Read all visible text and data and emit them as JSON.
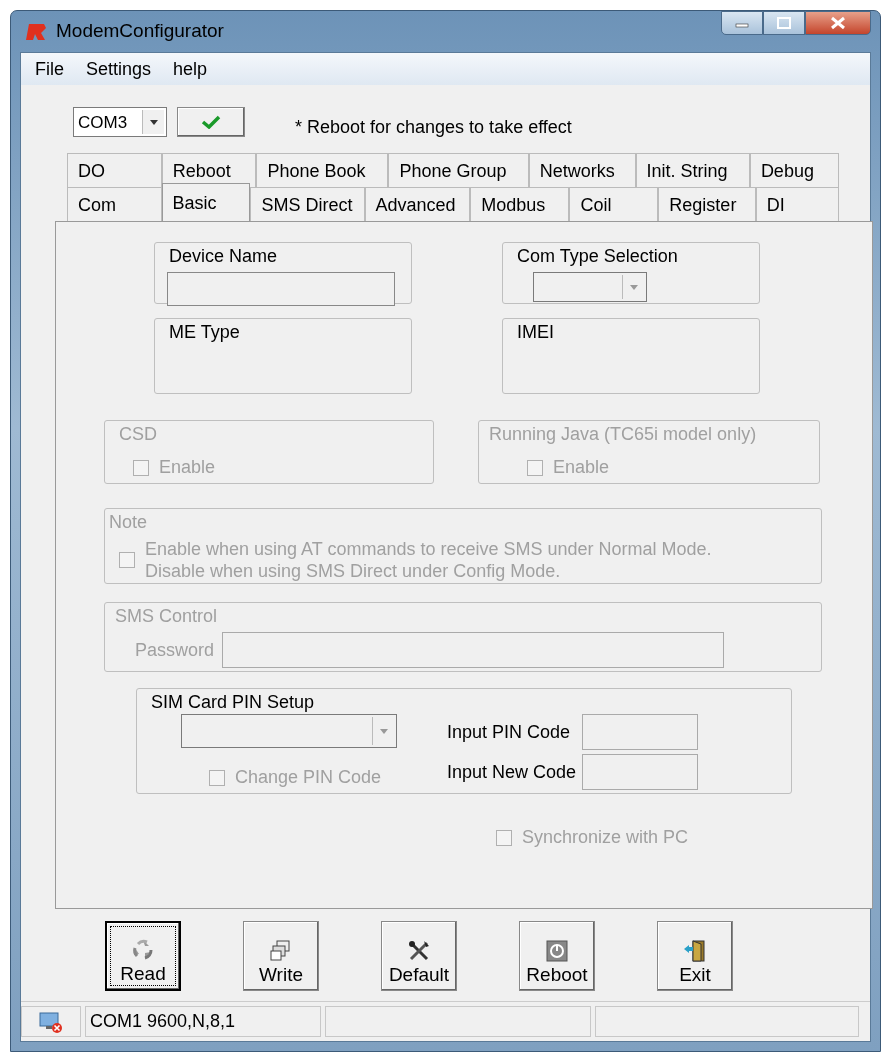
{
  "window": {
    "title": "ModemConfigurator"
  },
  "menu": [
    {
      "label": "File"
    },
    {
      "label": "Settings"
    },
    {
      "label": "help"
    }
  ],
  "toolbar": {
    "port": "COM3",
    "note": "* Reboot for changes to take effect"
  },
  "tab_rows": [
    [
      {
        "label": "DO",
        "selected": false
      },
      {
        "label": "Reboot",
        "selected": false
      },
      {
        "label": "Phone Book",
        "selected": false
      },
      {
        "label": "Phone Group",
        "selected": false
      },
      {
        "label": "Networks",
        "selected": false
      },
      {
        "label": "Init. String",
        "selected": false
      },
      {
        "label": "Debug",
        "selected": false
      }
    ],
    [
      {
        "label": "Com",
        "selected": false
      },
      {
        "label": "Basic",
        "selected": true
      },
      {
        "label": "SMS Direct",
        "selected": false
      },
      {
        "label": "Advanced",
        "selected": false
      },
      {
        "label": "Modbus",
        "selected": false
      },
      {
        "label": "Coil",
        "selected": false
      },
      {
        "label": "Register",
        "selected": false
      },
      {
        "label": "DI",
        "selected": false
      }
    ]
  ],
  "device_name": {
    "label": "Device Name"
  },
  "com_type_selection": {
    "label": "Com Type Selection",
    "disabled": true
  },
  "me_type": {
    "label": "ME Type"
  },
  "imei": {
    "label": "IMEI"
  },
  "csd": {
    "label": "CSD",
    "disabled": true,
    "checkbox": {
      "label": "Enable",
      "checked": false
    }
  },
  "running_java": {
    "label": "Running Java (TC65i model only)",
    "disabled": true,
    "checkbox": {
      "label": "Enable",
      "checked": false
    }
  },
  "note": {
    "label": "Note",
    "disabled": true,
    "checked": false,
    "lines": [
      "Enable when using AT commands to receive SMS under Normal Mode.",
      "Disable when using SMS Direct under Config Mode."
    ]
  },
  "sms_control": {
    "label": "SMS Control",
    "disabled": true,
    "password_label": "Password"
  },
  "sim_pin": {
    "label": "SIM Card PIN Setup",
    "change_pin": {
      "label": "Change PIN Code",
      "checked": false,
      "disabled": true
    },
    "input_pin_label": "Input PIN Code",
    "input_new_label": "Input New Code"
  },
  "synchronize": {
    "label": "Synchronize with PC",
    "checked": false,
    "disabled": true
  },
  "buttons": [
    {
      "label": "Read",
      "kind": "read",
      "focused": true
    },
    {
      "label": "Write",
      "kind": "write",
      "focused": false
    },
    {
      "label": "Default",
      "kind": "default",
      "focused": false
    },
    {
      "label": "Reboot",
      "kind": "reboot",
      "focused": false
    },
    {
      "label": "Exit",
      "kind": "exit",
      "focused": false
    }
  ],
  "status_bar": {
    "text": "COM1 9600,N,8,1"
  }
}
